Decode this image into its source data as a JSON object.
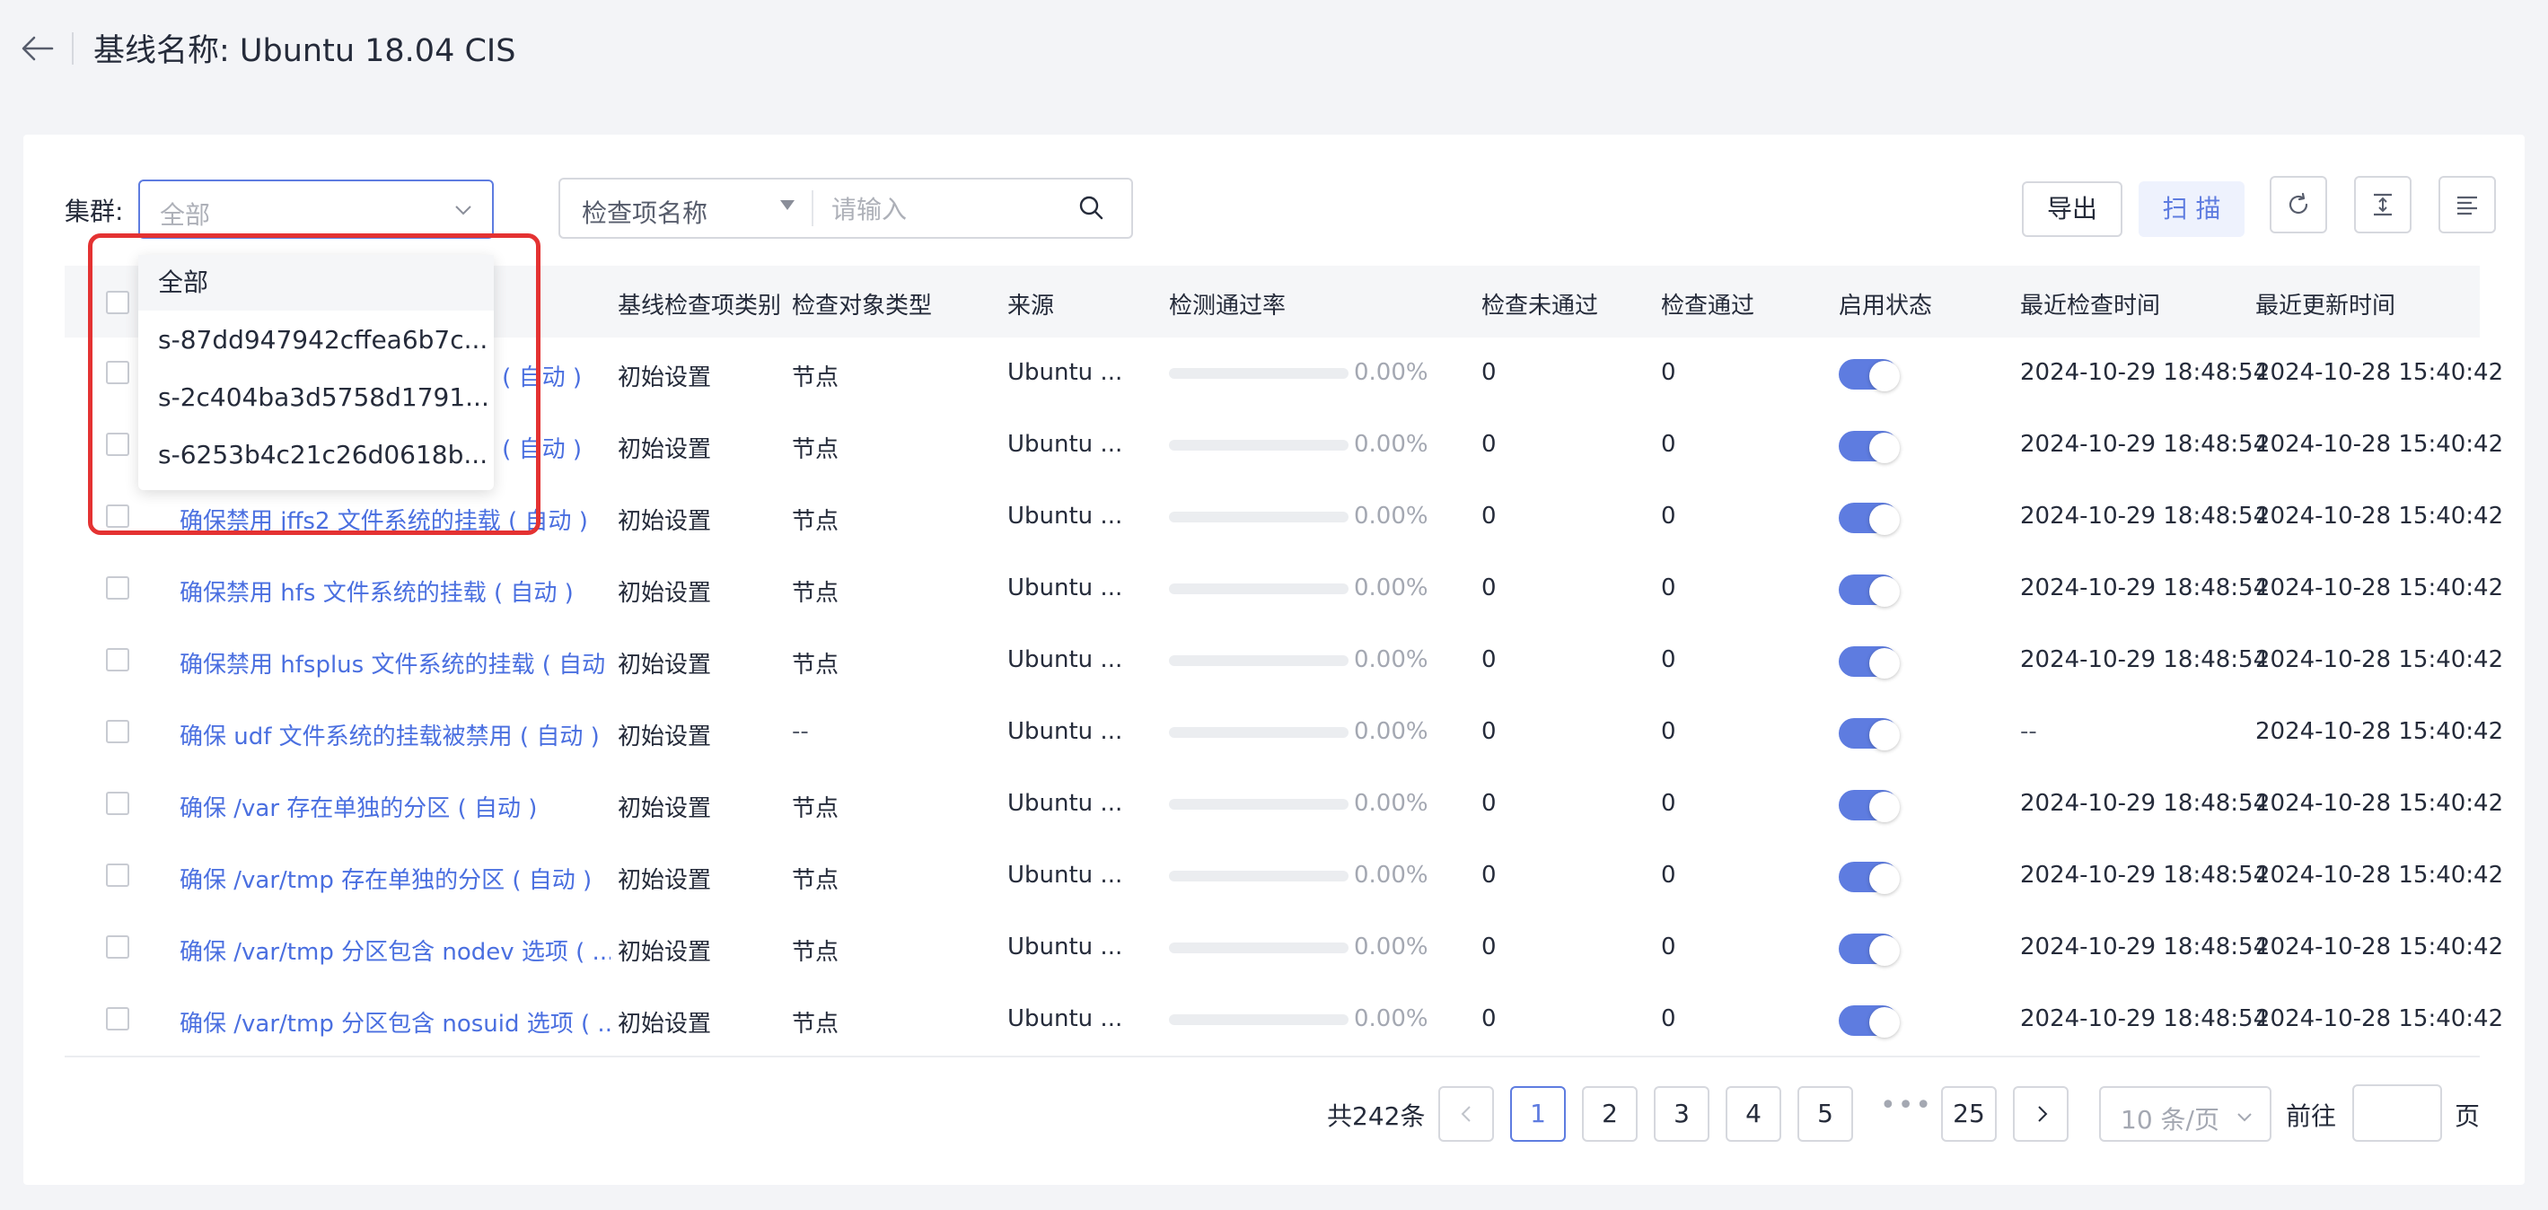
{
  "header": {
    "title": "基线名称: Ubuntu 18.04 CIS"
  },
  "filters": {
    "cluster_label": "集群:",
    "cluster_value": "全部",
    "search_field": "检查项名称",
    "search_placeholder": "请输入"
  },
  "toolbar": {
    "export_label": "导出",
    "scan_label": "扫 描"
  },
  "dropdown": {
    "options": [
      "全部",
      "s-87dd947942cffea6b7c...",
      "s-2c404ba3d5758d1791...",
      "s-6253b4c21c26d0618b..."
    ]
  },
  "table": {
    "columns": [
      "基线检查项类别",
      "检查对象类型",
      "来源",
      "检测通过率",
      "检查未通过",
      "检查通过",
      "启用状态",
      "最近检查时间",
      "最近更新时间"
    ],
    "rows": [
      {
        "name": "",
        "name_tail": "( 自动 )",
        "category": "初始设置",
        "target": "节点",
        "source": "Ubuntu ...",
        "rate": "0.00%",
        "rate_value": 0,
        "fail": "0",
        "pass": "0",
        "enabled": true,
        "last_check": "2024-10-29 18:48:54",
        "last_update": "2024-10-28 15:40:42"
      },
      {
        "name": "",
        "name_tail": "( 自动 )",
        "category": "初始设置",
        "target": "节点",
        "source": "Ubuntu ...",
        "rate": "0.00%",
        "rate_value": 0,
        "fail": "0",
        "pass": "0",
        "enabled": true,
        "last_check": "2024-10-29 18:48:54",
        "last_update": "2024-10-28 15:40:42"
      },
      {
        "name": "确保禁用 jffs2 文件系统的挂载 ( 自动 )",
        "category": "初始设置",
        "target": "节点",
        "source": "Ubuntu ...",
        "rate": "0.00%",
        "rate_value": 0,
        "fail": "0",
        "pass": "0",
        "enabled": true,
        "last_check": "2024-10-29 18:48:54",
        "last_update": "2024-10-28 15:40:42"
      },
      {
        "name": "确保禁用 hfs 文件系统的挂载 ( 自动 )",
        "category": "初始设置",
        "target": "节点",
        "source": "Ubuntu ...",
        "rate": "0.00%",
        "rate_value": 0,
        "fail": "0",
        "pass": "0",
        "enabled": true,
        "last_check": "2024-10-29 18:48:54",
        "last_update": "2024-10-28 15:40:42"
      },
      {
        "name": "确保禁用 hfsplus 文件系统的挂载 ( 自动 )",
        "category": "初始设置",
        "target": "节点",
        "source": "Ubuntu ...",
        "rate": "0.00%",
        "rate_value": 0,
        "fail": "0",
        "pass": "0",
        "enabled": true,
        "last_check": "2024-10-29 18:48:54",
        "last_update": "2024-10-28 15:40:42"
      },
      {
        "name": "确保 udf 文件系统的挂载被禁用 ( 自动 )",
        "category": "初始设置",
        "target": "--",
        "source": "Ubuntu ...",
        "rate": "0.00%",
        "rate_value": 0,
        "fail": "0",
        "pass": "0",
        "enabled": true,
        "last_check": "--",
        "last_update": "2024-10-28 15:40:42"
      },
      {
        "name": "确保 /var 存在单独的分区 ( 自动 )",
        "category": "初始设置",
        "target": "节点",
        "source": "Ubuntu ...",
        "rate": "0.00%",
        "rate_value": 0,
        "fail": "0",
        "pass": "0",
        "enabled": true,
        "last_check": "2024-10-29 18:48:54",
        "last_update": "2024-10-28 15:40:42"
      },
      {
        "name": "确保 /var/tmp 存在单独的分区 ( 自动 )",
        "category": "初始设置",
        "target": "节点",
        "source": "Ubuntu ...",
        "rate": "0.00%",
        "rate_value": 0,
        "fail": "0",
        "pass": "0",
        "enabled": true,
        "last_check": "2024-10-29 18:48:54",
        "last_update": "2024-10-28 15:40:42"
      },
      {
        "name": "确保 /var/tmp 分区包含 nodev 选项 ( ...",
        "category": "初始设置",
        "target": "节点",
        "source": "Ubuntu ...",
        "rate": "0.00%",
        "rate_value": 0,
        "fail": "0",
        "pass": "0",
        "enabled": true,
        "last_check": "2024-10-29 18:48:54",
        "last_update": "2024-10-28 15:40:42"
      },
      {
        "name": "确保 /var/tmp 分区包含 nosuid 选项 ( ...",
        "category": "初始设置",
        "target": "节点",
        "source": "Ubuntu ...",
        "rate": "0.00%",
        "rate_value": 0,
        "fail": "0",
        "pass": "0",
        "enabled": true,
        "last_check": "2024-10-29 18:48:54",
        "last_update": "2024-10-28 15:40:42"
      }
    ]
  },
  "pagination": {
    "total": "共242条",
    "pages": [
      "1",
      "2",
      "3",
      "4",
      "5"
    ],
    "ellipsis": "•••",
    "last_page": "25",
    "current": "1",
    "page_size": "10 条/页",
    "goto_label": "前往",
    "goto_unit": "页"
  },
  "colors": {
    "accent": "#5e7ce0",
    "link": "#4a6fe0",
    "highlight": "#e43232"
  }
}
